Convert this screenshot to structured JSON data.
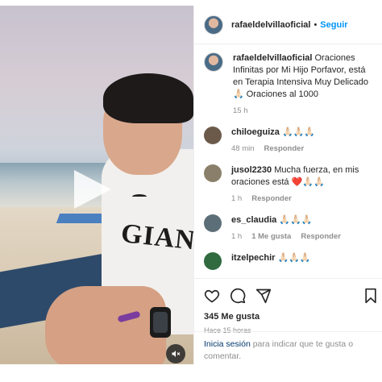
{
  "post": {
    "username": "rafaeldelvillaoficial",
    "follow_label": "Seguir",
    "separator": "•"
  },
  "caption": {
    "username": "rafaeldelvillaoficial",
    "text": "Oraciones Infinitas por Mi Hijo Porfavor, está en Terapia Intensiva Muy Delicado 🙏🏻 Oraciones al 1000",
    "time": "15 h"
  },
  "comments": [
    {
      "username": "chiloeguiza",
      "text": "🙏🏻🙏🏻🙏🏻",
      "time": "48 min",
      "likes": "",
      "reply": "Responder",
      "avatar_color": "#6b5a4a"
    },
    {
      "username": "jusol2230",
      "text": "Mucha fuerza, en mis oraciones está ❤️🙏🏻🙏🏻",
      "time": "1 h",
      "likes": "",
      "reply": "Responder",
      "avatar_color": "#8a7f6a"
    },
    {
      "username": "es_claudia",
      "text": "🙏🏻🙏🏻🙏🏻",
      "time": "1 h",
      "likes": "1 Me gusta",
      "reply": "Responder",
      "avatar_color": "#5c6f78"
    },
    {
      "username": "itzelpechir",
      "text": "🙏🏻🙏🏻🙏🏻",
      "time": "",
      "likes": "",
      "reply": "",
      "avatar_color": "#2f6b3f"
    }
  ],
  "actions": {
    "like_icon": "heart-icon",
    "comment_icon": "comment-icon",
    "share_icon": "share-icon",
    "save_icon": "bookmark-icon"
  },
  "likes_count": "345 Me gusta",
  "posted_ago": "Hace 15 horas",
  "login_prompt": {
    "link": "Inicia sesión",
    "text": " para indicar que te gusta o comentar."
  },
  "media": {
    "play_icon": "play-icon",
    "mute_icon": "speaker-muted-icon",
    "jersey_text": "GIANT"
  }
}
